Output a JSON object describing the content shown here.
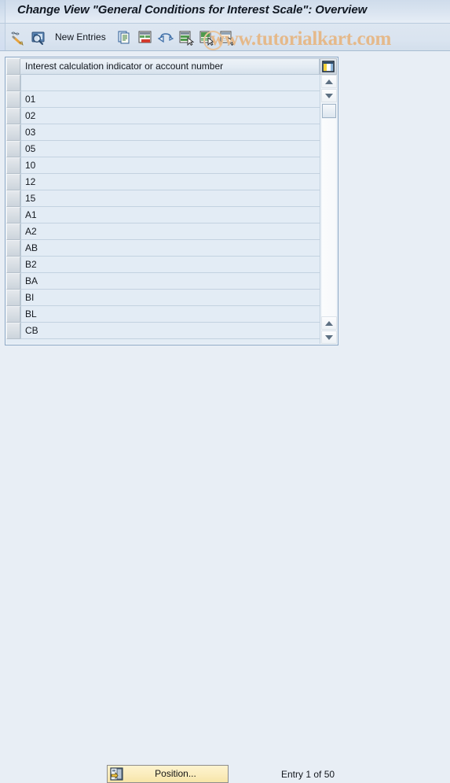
{
  "window": {
    "title": "Change View \"General Conditions for Interest Scale\": Overview"
  },
  "watermark": {
    "text": "www.tutorialkart.com",
    "color": "#e5b98a"
  },
  "toolbar": {
    "new_entries_label": "New Entries",
    "buttons": [
      {
        "name": "display-change-icon",
        "title": "Display/Change"
      },
      {
        "name": "check-entries-icon",
        "title": "Check Entries"
      },
      {
        "name": "copy-as-icon",
        "title": "Copy As..."
      },
      {
        "name": "delete-icon",
        "title": "Delete"
      },
      {
        "name": "undo-icon",
        "title": "Undo Change"
      },
      {
        "name": "select-all-icon",
        "title": "Select All"
      },
      {
        "name": "select-block-icon",
        "title": "Select Block"
      },
      {
        "name": "deselect-all-icon",
        "title": "Deselect All"
      }
    ]
  },
  "table": {
    "column_header": "Interest calculation indicator or account number",
    "settings_icon": "table-settings-icon",
    "rows": [
      {
        "value": ""
      },
      {
        "value": "01"
      },
      {
        "value": "02"
      },
      {
        "value": "03"
      },
      {
        "value": "05"
      },
      {
        "value": "10"
      },
      {
        "value": "12"
      },
      {
        "value": "15"
      },
      {
        "value": "A1"
      },
      {
        "value": "A2"
      },
      {
        "value": "AB"
      },
      {
        "value": "B2"
      },
      {
        "value": "BA"
      },
      {
        "value": "BI"
      },
      {
        "value": "BL"
      },
      {
        "value": "CB"
      }
    ]
  },
  "scrollbar": {
    "up_icon": "scroll-up-icon",
    "down_icon": "scroll-down-icon",
    "page_up_icon": "scroll-page-up-icon",
    "page_down_icon": "scroll-page-down-icon"
  },
  "footer": {
    "position_button_label": "Position...",
    "position_button_icon": "position-icon",
    "entry_status": "Entry 1 of 50"
  },
  "colors": {
    "background": "#e8eef5",
    "title_gradient_top": "#cfdceb",
    "table_row": "#e3ecf5",
    "button_yellow": "#fbeec0",
    "border": "#8ba7c4"
  }
}
